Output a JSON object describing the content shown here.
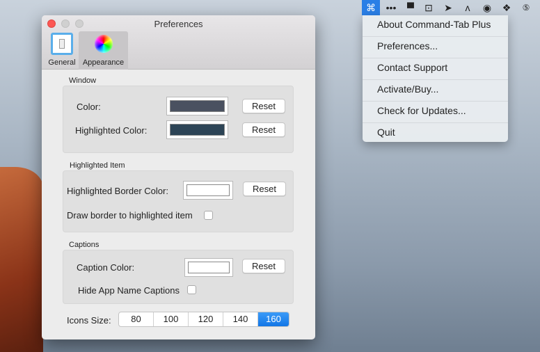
{
  "menubar": {
    "icons": [
      "command-tab-plus-icon",
      "more-dots-icon",
      "top-hat-icon",
      "download-box-icon",
      "arrow-forward-icon",
      "artstudio-icon",
      "sync-circle-icon",
      "dropbox-icon",
      "html5-icon"
    ]
  },
  "dropdown": {
    "items": [
      "About Command-Tab Plus",
      "Preferences...",
      "Contact Support",
      "Activate/Buy...",
      "Check for Updates...",
      "Quit"
    ]
  },
  "window": {
    "title": "Preferences",
    "tabs": [
      {
        "label": "General"
      },
      {
        "label": "Appearance"
      }
    ],
    "sections": {
      "window": {
        "title": "Window",
        "color_label": "Color:",
        "highlighted_color_label": "Highlighted Color:",
        "color_value": "#4a5160",
        "highlighted_color_value": "#2d4456"
      },
      "highlighted": {
        "title": "Highlighted Item",
        "border_color_label": "Highlighted Border Color:",
        "border_color_value": "#ffffff",
        "draw_border_label": "Draw border to highlighted item",
        "draw_border_checked": false
      },
      "captions": {
        "title": "Captions",
        "caption_color_label": "Caption Color:",
        "caption_color_value": "#ffffff",
        "hide_label": "Hide App Name Captions",
        "hide_checked": false
      }
    },
    "reset_label": "Reset",
    "icons_size": {
      "label": "Icons Size:",
      "options": [
        "80",
        "100",
        "120",
        "140",
        "160"
      ],
      "selected": "160"
    }
  }
}
